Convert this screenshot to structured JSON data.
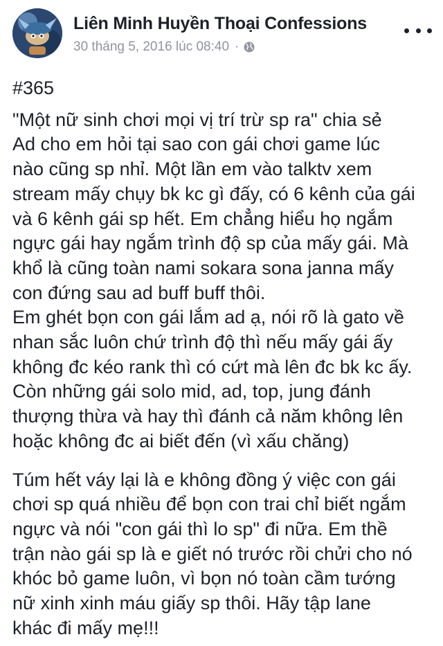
{
  "post": {
    "page_name": "Liên Minh Huyền Thoại Confessions",
    "timestamp": "30 tháng 5, 2016 lúc 08:40",
    "separator": "·",
    "privacy_icon": "globe-icon",
    "more_icon": "more-options-icon",
    "hashtag": "#365",
    "paragraph1_lines": [
      "\"Một nữ sinh chơi mọi vị trí trừ sp ra\" chia sẻ",
      "Ad cho em hỏi tại sao con gái chơi game lúc",
      "nào cũng sp nhỉ. Một lần em vào talktv xem",
      "stream mấy chụy bk kc gì đấy, có 6 kênh của gái",
      "và 6 kênh gái sp hết. Em chẳng hiểu họ ngắm",
      "ngực gái hay ngắm trình độ sp của mấy gái. Mà",
      "khổ là cũng toàn nami sokara sona janna mấy",
      "con đứng sau ad buff buff thôi.",
      "Em ghét bọn con gái lắm ad ạ, nói rõ là gato về",
      "nhan sắc luôn chứ trình độ thì nếu mấy gái ấy",
      "không đc kéo rank thì có cứt mà lên đc bk kc ấy.",
      "Còn những gái solo mid, ad, top, jung đánh",
      "thượng thừa và hay thì đánh cả năm không lên",
      "hoặc không đc ai biết đến (vì xấu chăng)"
    ],
    "paragraph2_lines": [
      "Túm hết váy lại là e không đồng ý việc con gái",
      "chơi sp quá nhiều để bọn con trai chỉ biết ngắm",
      "ngực và nói \"con gái thì lo sp\" đi nữa. Em thề",
      "trận nào gái sp là e giết nó trước rồi chửi cho nó",
      "khóc bỏ game luôn, vì bọn nó toàn cầm tướng",
      "nữ xinh xinh máu giấy sp thôi. Hãy tập lane",
      "khác đi mấy mẹ!!!"
    ]
  }
}
